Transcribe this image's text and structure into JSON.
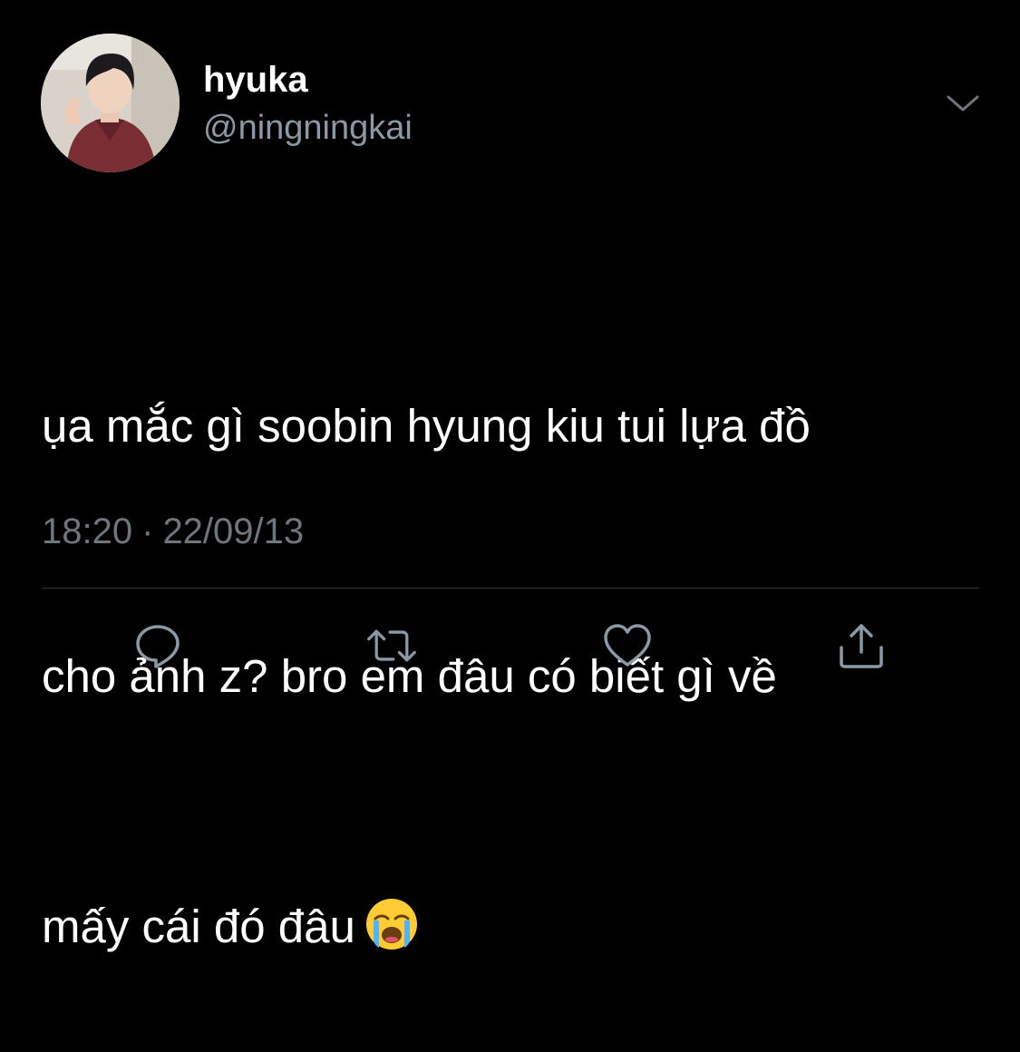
{
  "user": {
    "display_name": "hyuka",
    "handle": "@ningningkai",
    "avatar": "profile-photo"
  },
  "tweet": {
    "lines": [
      "ụa mắc gì soobin hyung kiu tui lựa đồ",
      "cho ảnh z? bro em đâu có biết gì về",
      "mấy cái đó đâu"
    ],
    "emoji": "loudly-crying-face",
    "time": "18:20",
    "separator": "·",
    "date": "22/09/13"
  },
  "actions": {
    "reply_icon": "reply-icon",
    "retweet_icon": "retweet-icon",
    "like_icon": "heart-icon",
    "share_icon": "share-icon",
    "more_icon": "chevron-down-icon"
  },
  "colors": {
    "background": "#000000",
    "text_primary": "#ffffff",
    "text_secondary": "#8b98a5",
    "meta": "#6e767d",
    "icon": "#8b98a5",
    "divider": "#2f3336"
  }
}
